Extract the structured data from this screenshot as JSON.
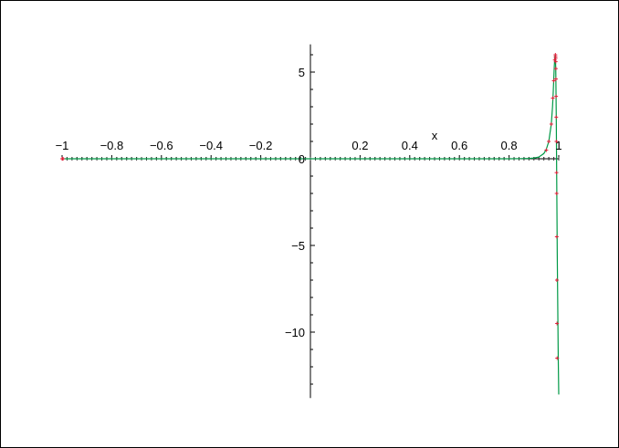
{
  "chart_data": {
    "type": "line",
    "xlabel": "x",
    "ylabel": "",
    "xlim": [
      -1.0,
      1.0
    ],
    "ylim": [
      -13.8,
      6.6
    ],
    "x_ticks": [
      -1,
      -0.8,
      -0.6,
      -0.4,
      -0.2,
      0.2,
      0.4,
      0.6,
      0.8,
      1
    ],
    "x_tick_labels": [
      "−1",
      "−0.8",
      "−0.6",
      "−0.4",
      "−0.2",
      "0.2",
      "0.4",
      "0.6",
      "0.8",
      "1"
    ],
    "y_major_ticks": [
      -10,
      -5,
      0,
      5
    ],
    "y_tick_labels": [
      "−10",
      "−5",
      "0",
      "5"
    ],
    "y_minor_step": 1,
    "x_minor_step": 0.02,
    "grid": false,
    "series": [
      {
        "kind": "line",
        "color": "#009946",
        "x": [
          -1.0,
          0.8,
          0.85,
          0.88,
          0.9,
          0.92,
          0.94,
          0.95,
          0.96,
          0.97,
          0.975,
          0.978,
          0.98,
          0.982,
          0.984,
          0.986,
          0.988,
          0.99,
          0.992,
          0.994,
          0.996,
          0.998,
          1.0
        ],
        "y": [
          0.0,
          0.0,
          0.01,
          0.02,
          0.04,
          0.1,
          0.3,
          0.55,
          1.0,
          2.0,
          3.0,
          3.9,
          4.6,
          5.3,
          5.8,
          6.0,
          5.2,
          2.5,
          -1.5,
          -5.5,
          -8.5,
          -11.5,
          -13.6
        ]
      },
      {
        "kind": "points",
        "marker": "+",
        "color": "#e0203a",
        "x": [
          -1.0,
          -0.999,
          -0.998,
          -0.996,
          0.95,
          0.96,
          0.97,
          0.976,
          0.98,
          0.984,
          0.9865,
          0.987,
          0.9875,
          0.988,
          0.9885,
          0.989,
          0.9895,
          0.99,
          0.9905,
          0.991,
          0.9915,
          0.992,
          0.9925,
          0.993,
          0.9935
        ],
        "y": [
          0.0,
          0.0,
          0.0,
          0.0,
          0.5,
          1.0,
          2.0,
          3.5,
          4.5,
          5.7,
          6.0,
          5.9,
          5.8,
          5.6,
          5.2,
          4.6,
          3.6,
          2.4,
          1.0,
          -0.8,
          -2.0,
          -4.5,
          -7.0,
          -9.5,
          -11.5
        ]
      }
    ],
    "dotted_baseline": {
      "color": "#3a3a3a",
      "y": 0.0,
      "x_start": -1.0,
      "x_end": 1.0,
      "step": 0.02
    }
  }
}
